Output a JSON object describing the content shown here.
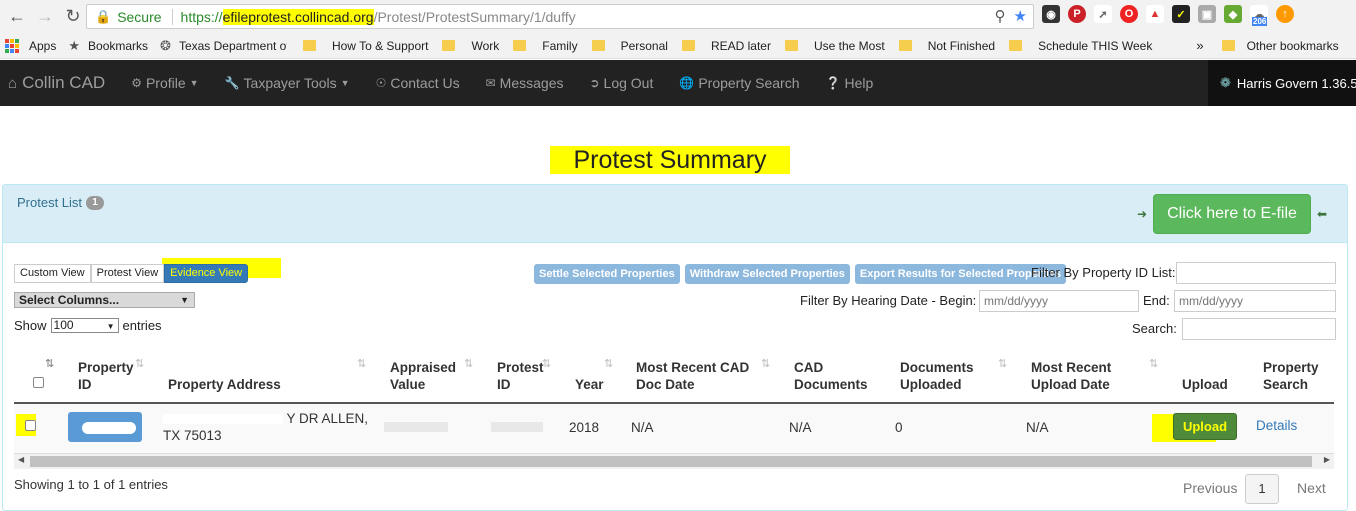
{
  "browser": {
    "secure_label": "Secure",
    "url_prefix": "https://",
    "url_host": "efileprotest.collincad.org",
    "url_path": "/Protest/ProtestSummary/1/duffy",
    "ext_badge": "206"
  },
  "bookmarks": {
    "apps": "Apps",
    "items": [
      "Bookmarks",
      "Texas Department of",
      "How To & Support",
      "Work",
      "Family",
      "Personal",
      "READ later",
      "Use the Most",
      "Not Finished",
      "Schedule THIS Week"
    ],
    "overflow": "»",
    "other": "Other bookmarks"
  },
  "navbar": {
    "brand": "Collin CAD",
    "items": [
      "Profile",
      "Taxpayer Tools",
      "Contact Us",
      "Messages",
      "Log Out",
      "Property Search",
      "Help"
    ],
    "right": "Harris Govern 1.36.5"
  },
  "page": {
    "title": "Protest Summary",
    "protest_list_label": "Protest List",
    "protest_list_count": "1",
    "efile_button": "Click here to E-file"
  },
  "views": [
    "Custom View",
    "Protest View",
    "Evidence View"
  ],
  "actions": [
    "Settle Selected Properties",
    "Withdraw Selected Properties",
    "Export Results for Selected Properties"
  ],
  "filters": {
    "property_id_label": "Filter By Property ID List:",
    "hearing_begin_label": "Filter By Hearing Date - Begin:",
    "end_label": "End:",
    "date_placeholder": "mm/dd/yyyy",
    "search_label": "Search:"
  },
  "columns_select": "Select Columns...",
  "show": {
    "prefix": "Show",
    "value": "100",
    "suffix": "entries"
  },
  "table": {
    "headers": {
      "property_id": [
        "Property",
        "ID"
      ],
      "address": "Property Address",
      "appraised": [
        "Appraised",
        "Value"
      ],
      "protest_id": [
        "Protest",
        "ID"
      ],
      "year": "Year",
      "most_recent_cad": [
        "Most Recent CAD",
        "Doc Date"
      ],
      "cad_docs": [
        "CAD",
        "Documents"
      ],
      "docs_uploaded": [
        "Documents",
        "Uploaded"
      ],
      "recent_upload": [
        "Most Recent",
        "Upload Date"
      ],
      "upload": "Upload",
      "property_search": [
        "Property",
        "Search"
      ]
    },
    "row": {
      "address_line1": "Y DR ALLEN,",
      "address_line2": "TX 75013",
      "year": "2018",
      "cad_doc_date": "N/A",
      "cad_documents": "N/A",
      "docs_uploaded": "0",
      "recent_upload": "N/A",
      "upload_button": "Upload",
      "details": "Details"
    }
  },
  "footer": {
    "info": "Showing 1 to 1 of 1 entries",
    "previous": "Previous",
    "page": "1",
    "next": "Next"
  },
  "colors": {
    "highlight": "#ffff00",
    "navbar": "#222222",
    "efile_green": "#5cb85c",
    "link_blue": "#337ab7",
    "panel_head": "#d9edf7"
  }
}
